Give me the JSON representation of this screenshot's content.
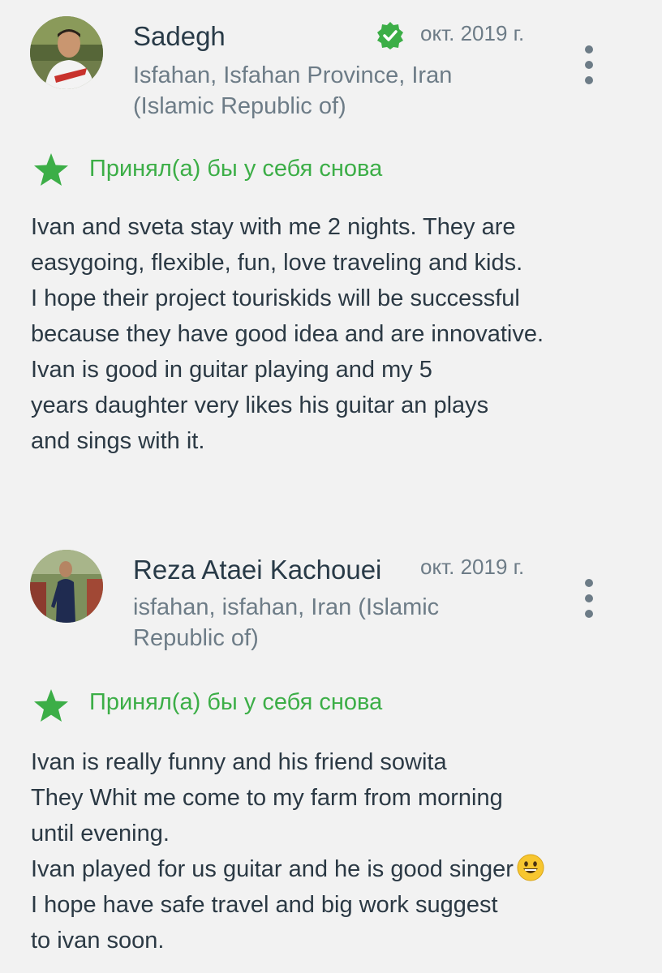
{
  "reviews": [
    {
      "author": "Sadegh",
      "location_lines": [
        "Isfahan, Isfahan Province, Iran",
        "(Islamic Republic of)"
      ],
      "date": "окт. 2019 г.",
      "verified": true,
      "recommendation": "Принял(а) бы у себя снова",
      "body_lines": [
        "Ivan and sveta stay with me 2 nights. They are",
        "easygoing, flexible, fun, love traveling and kids.",
        "I hope their project touriskids will be successful",
        "because they have good idea and are innovative.",
        "Ivan is good in guitar playing and my 5",
        "years daughter very likes his guitar an plays",
        "and sings with it."
      ]
    },
    {
      "author": "Reza Ataei Kachouei",
      "location_lines": [
        "isfahan, isfahan, Iran (Islamic",
        "Republic of)"
      ],
      "date": "окт. 2019 г.",
      "verified": false,
      "recommendation": "Принял(а) бы у себя снова",
      "body_lines": [
        "Ivan is really funny and his friend sowita",
        "They Whit me come to my farm from morning",
        "until evening.",
        "Ivan played for us guitar and he is good singer",
        "I hope have safe travel and big work suggest",
        "to ivan soon."
      ],
      "emoji": "grinning-face-emoji"
    }
  ],
  "colors": {
    "background": "#f2f2f2",
    "accent_green": "#3cae47",
    "name_text": "#283a47",
    "muted_text": "#6d7c87",
    "body_text": "#2b3944"
  },
  "icons": {
    "verified": "verified-check-icon",
    "menu": "more-vert-icon",
    "recommend": "star-icon"
  }
}
